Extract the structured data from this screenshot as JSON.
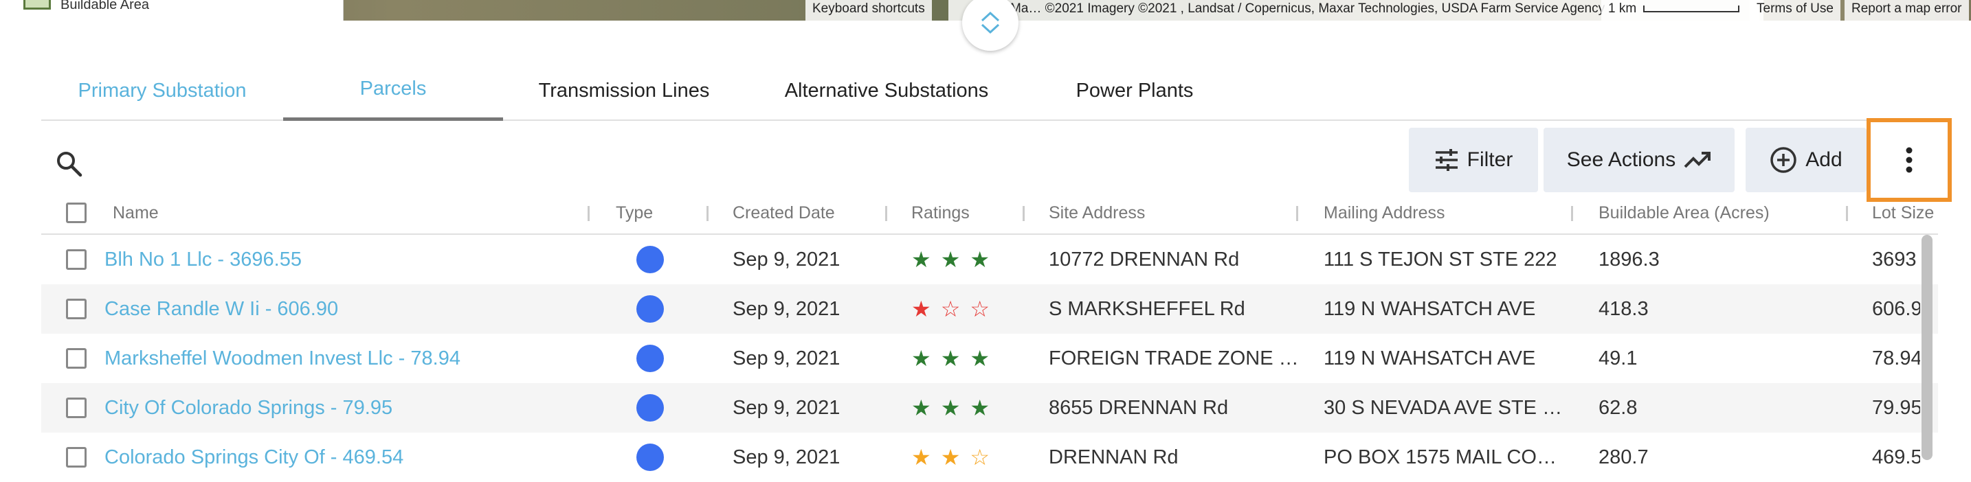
{
  "map": {
    "legend_label": "Buildable Area",
    "attribution_left": "Keyboard shortcuts",
    "attribution_main": "Ma… ©2021 Imagery ©2021 , Landsat / Copernicus, Maxar Technologies, USDA Farm Service Agency",
    "scale_label": "1 km",
    "terms": "Terms of Use",
    "report": "Report a map error"
  },
  "tabs": [
    {
      "label": "Primary Substation"
    },
    {
      "label": "Parcels"
    },
    {
      "label": "Transmission Lines"
    },
    {
      "label": "Alternative Substations"
    },
    {
      "label": "Power Plants"
    }
  ],
  "toolbar": {
    "filter_label": "Filter",
    "actions_label": "See Actions",
    "add_label": "Add"
  },
  "table": {
    "headers": [
      "Name",
      "Type",
      "Created Date",
      "Ratings",
      "Site Address",
      "Mailing Address",
      "Buildable Area (Acres)",
      "Lot Size"
    ],
    "rows": [
      {
        "name": "Blh No 1 Llc - 3696.55",
        "date": "Sep 9, 2021",
        "rating": 3,
        "site": "10772 DRENNAN Rd",
        "mailing": "111 S TEJON ST STE 222",
        "area": "1896.3",
        "lot": "3693"
      },
      {
        "name": "Case Randle W Ii - 606.90",
        "date": "Sep 9, 2021",
        "rating": 1,
        "site": "S MARKSHEFFEL Rd",
        "mailing": "119 N WAHSATCH AVE",
        "area": "418.3",
        "lot": "606.9"
      },
      {
        "name": "Marksheffel Woodmen Invest Llc - 78.94",
        "date": "Sep 9, 2021",
        "rating": 3,
        "site": "FOREIGN TRADE ZONE …",
        "mailing": "119 N WAHSATCH AVE",
        "area": "49.1",
        "lot": "78.94"
      },
      {
        "name": "City Of Colorado Springs - 79.95",
        "date": "Sep 9, 2021",
        "rating": 3,
        "site": "8655 DRENNAN Rd",
        "mailing": "30 S NEVADA AVE STE …",
        "area": "62.8",
        "lot": "79.95"
      },
      {
        "name": "Colorado Springs City Of - 469.54",
        "date": "Sep 9, 2021",
        "rating": 2,
        "site": "DRENNAN Rd",
        "mailing": "PO BOX 1575 MAIL CO…",
        "area": "280.7",
        "lot": "469.5"
      }
    ]
  },
  "colors": {
    "accent": "#5ab3dc",
    "highlight": "#f0922b",
    "star_green": "#2e7d32",
    "star_red": "#e53935",
    "star_orange": "#f5a623",
    "type_dot": "#3b6ff0"
  }
}
